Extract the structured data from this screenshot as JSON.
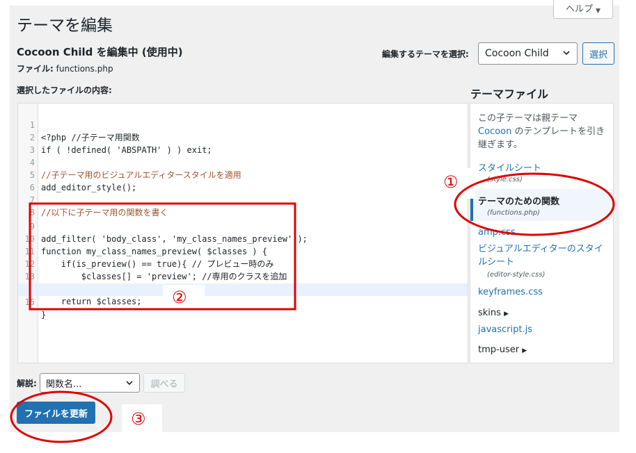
{
  "header": {
    "help_label": "ヘルプ",
    "page_title": "テーマを編集",
    "subtitle": "Cocoon Child を編集中 (使用中)",
    "file_label": "ファイル:",
    "file_name": "functions.php"
  },
  "theme_selector": {
    "label": "編集するテーマを選択:",
    "selected": "Cocoon Child",
    "button": "選択"
  },
  "editor": {
    "label": "選択したファイルの内容:",
    "lines": [
      {
        "n": "1",
        "text": "<?php //子テーマ用関数"
      },
      {
        "n": "2",
        "text": "if ( !defined( 'ABSPATH' ) ) exit;"
      },
      {
        "n": "3",
        "text": ""
      },
      {
        "n": "4",
        "text": "//子テーマ用のビジュアルエディタースタイルを適用"
      },
      {
        "n": "5",
        "text": "add_editor_style();"
      },
      {
        "n": "6",
        "text": ""
      },
      {
        "n": "7",
        "text": "//以下に子テーマ用の関数を書く"
      },
      {
        "n": "8",
        "text": ""
      },
      {
        "n": "9",
        "text": "add_filter( 'body_class', 'my_class_names_preview' );"
      },
      {
        "n": "10",
        "text": "function my_class_names_preview( $classes ) {"
      },
      {
        "n": "11",
        "text": "    if(is_preview() == true){ // プレビュー時のみ"
      },
      {
        "n": "12",
        "text": "        $classes[] = 'preview'; //専用のクラスを追加"
      },
      {
        "n": "13",
        "text": "    }"
      },
      {
        "n": "14",
        "text": "    return $classes;"
      },
      {
        "n": "15",
        "text": "}"
      }
    ]
  },
  "sidebar": {
    "heading": "テーマファイル",
    "desc_pre": "この子テーマは親テーマ",
    "desc_link": "Cocoon",
    "desc_post": "のテンプレートを引き継ぎます。",
    "items": {
      "stylesheet": "スタイルシート",
      "stylesheet_file": "(style.css)",
      "functions": "テーマのための関数",
      "functions_file": "(functions.php)",
      "amp": "amp.css",
      "visual_editor": "ビジュアルエディターのスタイルシート",
      "visual_editor_file": "(editor-style.css)",
      "keyframes": "keyframes.css",
      "skins": "skins",
      "javascript": "javascript.js",
      "tmp_user": "tmp-user"
    }
  },
  "documentation": {
    "label": "解説:",
    "placeholder": "関数名...",
    "lookup": "調べる"
  },
  "update_button": "ファイルを更新",
  "annotations": {
    "one": "①",
    "two": "②",
    "three": "③",
    "color": "#e00000"
  }
}
